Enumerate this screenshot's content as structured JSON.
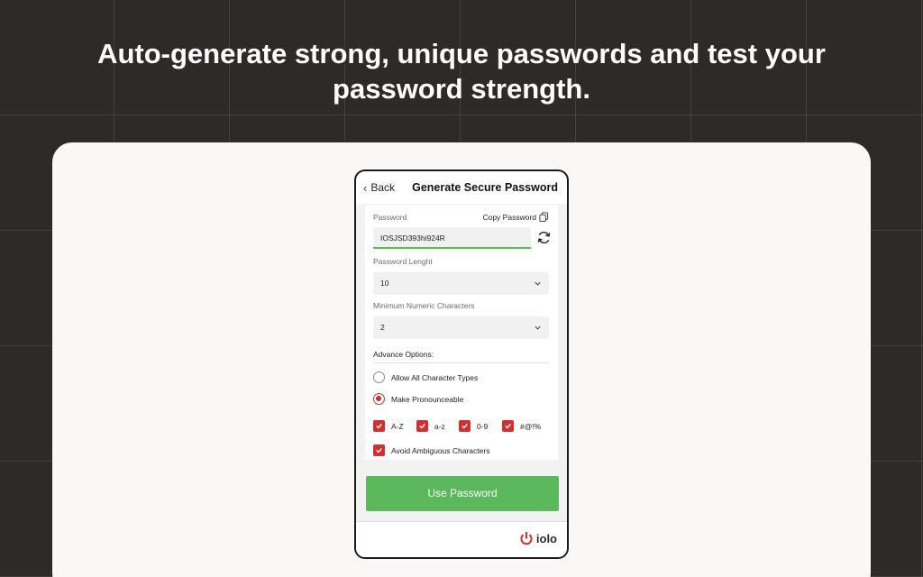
{
  "headline": {
    "line1": "Auto-generate strong, unique passwords and test your",
    "line2": "password strength."
  },
  "phone": {
    "back_label": "Back",
    "title": "Generate Secure Password",
    "password": {
      "label": "Password",
      "copy_label": "Copy Password",
      "value": "IOSJSD393hi924R"
    },
    "length": {
      "label": "Password Lenght",
      "selected": "10"
    },
    "numeric": {
      "label": "Minimum Numeric Characters",
      "selected": "2"
    },
    "advanced": {
      "title": "Advance Options:",
      "radio_all": "Allow All Character Types",
      "radio_pronounceable": "Make Pronounceable",
      "selected_radio": "Make Pronounceable",
      "cb_upper": "A-Z",
      "cb_lower": "a-z",
      "cb_digits": "0-9",
      "cb_symbols": "#@!%",
      "cb_ambiguous": "Avoid Ambiguous Characters"
    },
    "use_button": "Use Password",
    "logo_text": "iolo"
  },
  "colors": {
    "background": "#2e2a27",
    "card": "#faf7f6",
    "accent_green": "#5cb85c",
    "accent_red": "#d32f2f"
  },
  "icons": [
    "chevron-left-icon",
    "copy-icon",
    "refresh-icon",
    "chevron-down-icon",
    "check-icon",
    "power-icon"
  ]
}
